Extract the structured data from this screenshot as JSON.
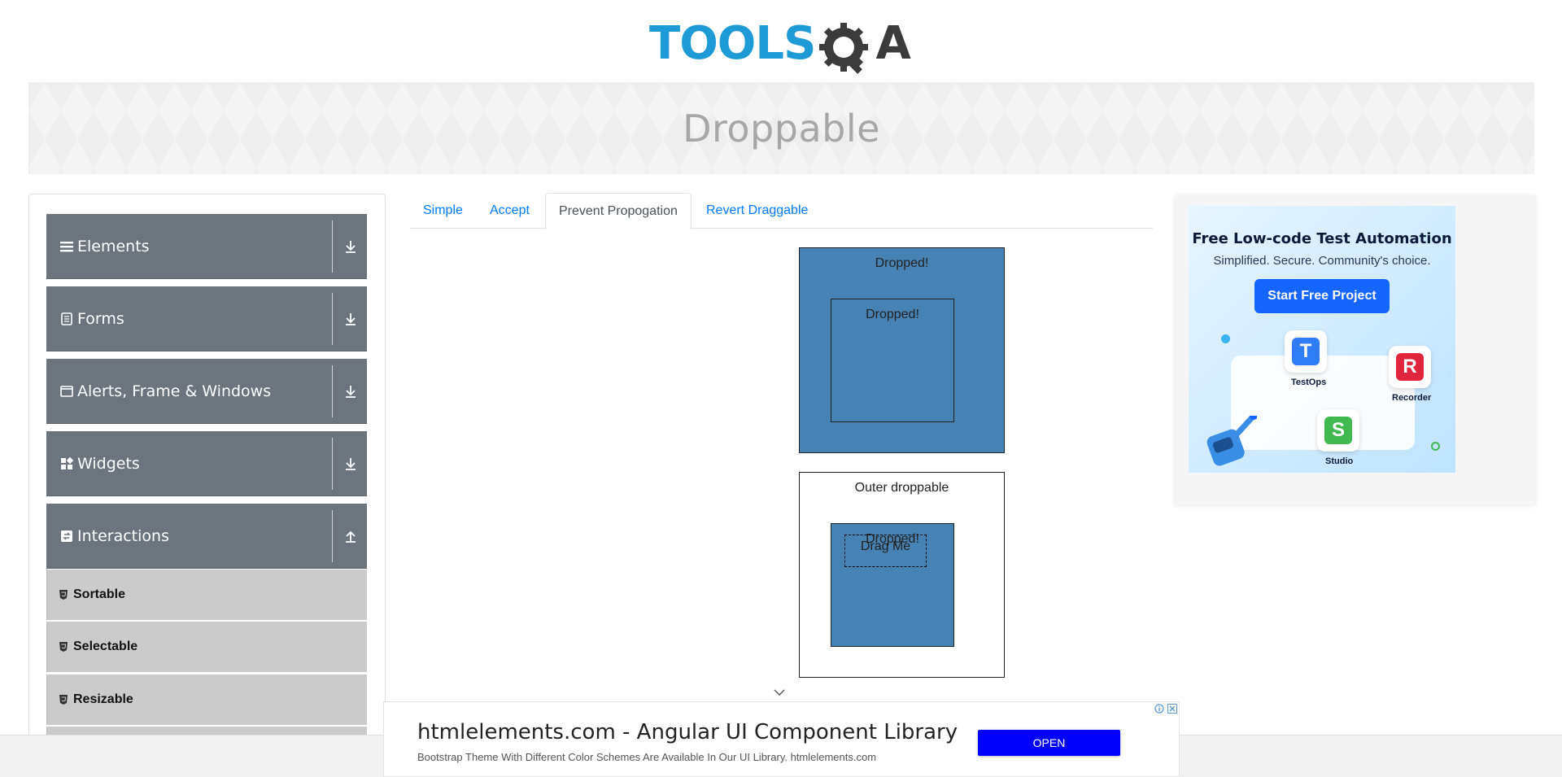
{
  "header": {
    "logo_tools": "TOOLS",
    "logo_a": "A",
    "page_title": "Droppable"
  },
  "sidebar": {
    "groups": [
      {
        "label": "Elements",
        "icon": "hamburger-icon"
      },
      {
        "label": "Forms",
        "icon": "form-icon"
      },
      {
        "label": "Alerts, Frame & Windows",
        "icon": "window-icon"
      },
      {
        "label": "Widgets",
        "icon": "widgets-icon"
      },
      {
        "label": "Interactions",
        "icon": "interactions-icon",
        "expanded": true
      }
    ],
    "sub_items": [
      {
        "label": "Sortable"
      },
      {
        "label": "Selectable"
      },
      {
        "label": "Resizable"
      }
    ]
  },
  "tabs": [
    {
      "label": "Simple"
    },
    {
      "label": "Accept"
    },
    {
      "label": "Prevent Propogation",
      "active": true
    },
    {
      "label": "Revert Draggable"
    }
  ],
  "droppable": {
    "greedy_outer_label": "Dropped!",
    "greedy_inner_label": "Dropped!",
    "outer_label": "Outer droppable",
    "inner_label": "Dropped!",
    "drag_label": "Drag Me"
  },
  "ad_right": {
    "title": "Free Low-code Test Automation",
    "subtitle": "Simplified. Secure. Community's choice.",
    "button": "Start Free Project",
    "cards": [
      {
        "letter": "T",
        "caption": "TestOps",
        "color": "#2f7cf6"
      },
      {
        "letter": "R",
        "caption": "Recorder",
        "color": "#e0263d"
      },
      {
        "letter": "S",
        "caption": "Studio",
        "color": "#3fb950"
      }
    ]
  },
  "ad_bottom": {
    "title": "htmlelements.com - Angular UI Component Library",
    "subtitle": "Bootstrap Theme With Different Color Schemes Are Available In Our UI Library. htmlelements.com",
    "button": "OPEN"
  },
  "colors": {
    "brand_blue": "#1e9bd7",
    "sidebar_group": "#6c757d",
    "sidebar_sub": "#cbcbcb",
    "droppable_active": "#4682b4",
    "link": "#007bff"
  }
}
